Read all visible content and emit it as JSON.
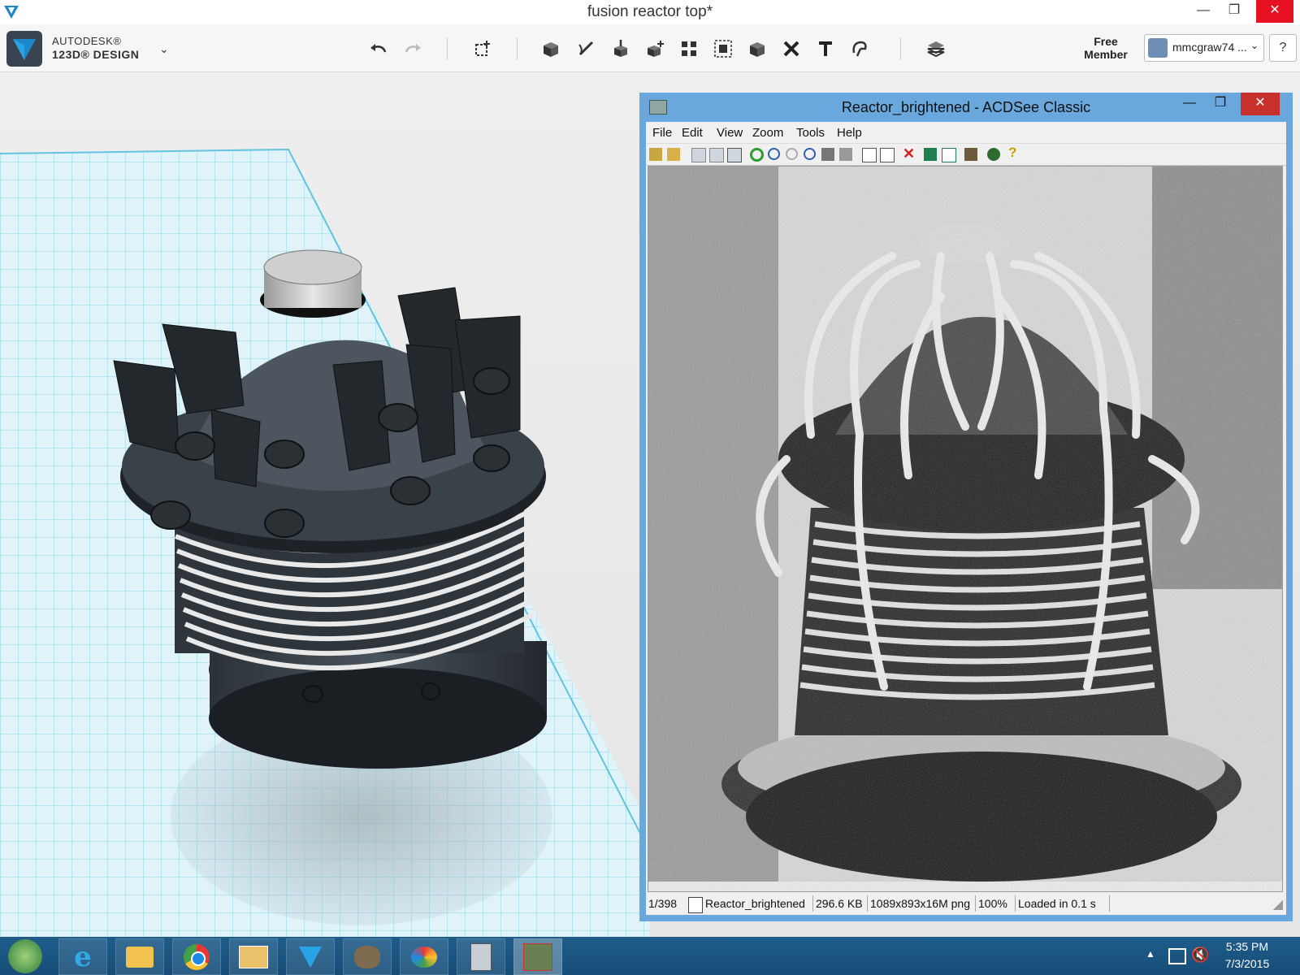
{
  "app": {
    "title": "fusion reactor top*",
    "brand_line1": "AUTODESK®",
    "brand_line2": "123D® DESIGN",
    "brand_menu_glyph": "⌄",
    "member_line1": "Free",
    "member_line2": "Member",
    "user_name": "mmcgraw74 ...",
    "help_label": "?",
    "window_controls": {
      "minimize": "—",
      "restore": "❐",
      "close": "✕"
    },
    "toolbar_icons": [
      "undo-icon",
      "redo-icon",
      "transform-icon",
      "primitives-icon",
      "sketch-icon",
      "construct-icon",
      "modify-icon",
      "pattern-icon",
      "grouping-icon",
      "combine-icon",
      "delete-icon",
      "text-icon",
      "snap-icon",
      "material-icon"
    ],
    "accent_color": "#1d88c9"
  },
  "acdsee": {
    "title": "Reactor_brightened - ACDSee Classic",
    "menu": [
      "File",
      "Edit",
      "View",
      "Zoom",
      "Tools",
      "Help"
    ],
    "status": {
      "index": "1/398",
      "filename": "Reactor_brightened",
      "size": "296.6 KB",
      "dimensions": "1089x893x16M png",
      "zoom": "100%",
      "loaded": "Loaded in 0.1 s"
    },
    "window_controls": {
      "minimize": "—",
      "restore": "❐",
      "close": "✕"
    }
  },
  "taskbar": {
    "time": "5:35 PM",
    "date": "7/3/2015",
    "apps": [
      "start-icon",
      "internet-explorer-icon",
      "file-explorer-icon",
      "chrome-icon",
      "mail-icon",
      "123d-design-icon",
      "gimp-icon",
      "paint-icon",
      "calculator-icon",
      "acdsee-icon"
    ]
  }
}
